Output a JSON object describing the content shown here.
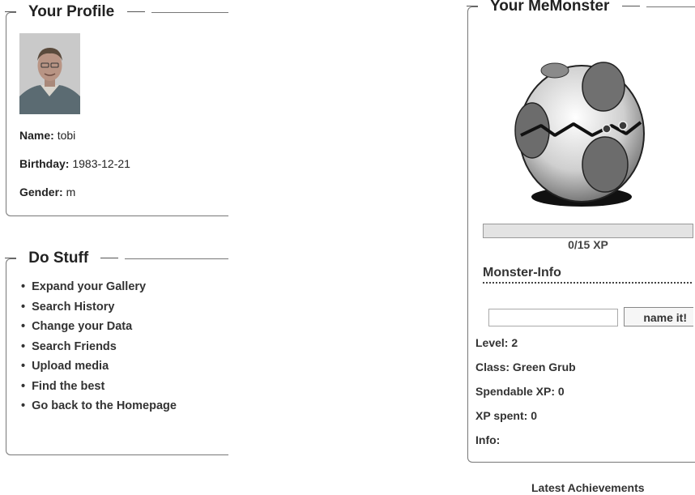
{
  "profile": {
    "legend": "Your Profile",
    "name_label": "Name:",
    "name_value": "tobi",
    "birthday_label": "Birthday:",
    "birthday_value": "1983-12-21",
    "gender_label": "Gender:",
    "gender_value": "m"
  },
  "do_stuff": {
    "legend": "Do Stuff",
    "items": [
      "Expand your Gallery",
      "Search History",
      "Change your Data",
      "Search Friends",
      "Upload media",
      "Find the best",
      "Go back to the Homepage"
    ]
  },
  "monster": {
    "legend": "Your MeMonster",
    "xp_current": 0,
    "xp_max": 15,
    "xp_text": "0/15 XP",
    "info_title": "Monster-Info",
    "name_input_value": "",
    "name_button": "name it!",
    "level_label": "Level:",
    "level_value": "2",
    "class_label": "Class:",
    "class_value": "Green Grub",
    "spendable_label": "Spendable XP:",
    "spendable_value": "0",
    "spent_label": "XP spent:",
    "spent_value": "0",
    "info_label": "Info:"
  },
  "latest_achievements_title": "Latest Achievements"
}
